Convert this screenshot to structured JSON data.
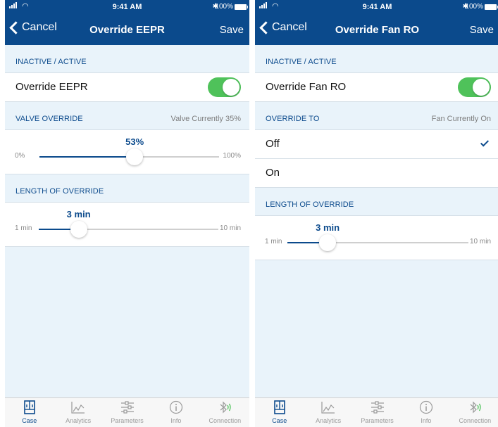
{
  "status_bar": {
    "time": "9:41 AM",
    "battery": "100%",
    "bluetooth_glyph": "✱"
  },
  "colors": {
    "nav": "#0b4a8c",
    "accent": "#0b4a8c",
    "toggle_on": "#4fc25a",
    "background": "#e9f3fa"
  },
  "left": {
    "nav": {
      "cancel": "Cancel",
      "title": "Override EEPR",
      "save": "Save"
    },
    "section_active": {
      "label": "INACTIVE / ACTIVE"
    },
    "toggle_row": {
      "label": "Override EEPR",
      "on": true
    },
    "valve_header": {
      "label": "VALVE OVERRIDE",
      "status": "Valve Currently 35%"
    },
    "valve_slider": {
      "value_label": "53%",
      "value": 53,
      "min": 0,
      "max": 100,
      "min_label": "0%",
      "max_label": "100%"
    },
    "length_header": {
      "label": "LENGTH OF OVERRIDE"
    },
    "length_slider": {
      "value_label": "3 min",
      "value": 3,
      "min": 1,
      "max": 10,
      "min_label": "1 min",
      "max_label": "10 min"
    }
  },
  "right": {
    "nav": {
      "cancel": "Cancel",
      "title": "Override Fan RO",
      "save": "Save"
    },
    "section_active": {
      "label": "INACTIVE / ACTIVE"
    },
    "toggle_row": {
      "label": "Override Fan RO",
      "on": true
    },
    "override_header": {
      "label": "OVERRIDE TO",
      "status": "Fan Currently On"
    },
    "options": [
      {
        "label": "Off",
        "selected": true
      },
      {
        "label": "On",
        "selected": false
      }
    ],
    "length_header": {
      "label": "LENGTH OF OVERRIDE"
    },
    "length_slider": {
      "value_label": "3 min",
      "value": 3,
      "min": 1,
      "max": 10,
      "min_label": "1 min",
      "max_label": "10 min"
    }
  },
  "tabs": [
    {
      "label": "Case",
      "icon": "case-icon",
      "active": true
    },
    {
      "label": "Analytics",
      "icon": "analytics-icon",
      "active": false
    },
    {
      "label": "Parameters",
      "icon": "parameters-icon",
      "active": false
    },
    {
      "label": "Info",
      "icon": "info-icon",
      "active": false
    },
    {
      "label": "Connection",
      "icon": "connection-icon",
      "active": false
    }
  ]
}
